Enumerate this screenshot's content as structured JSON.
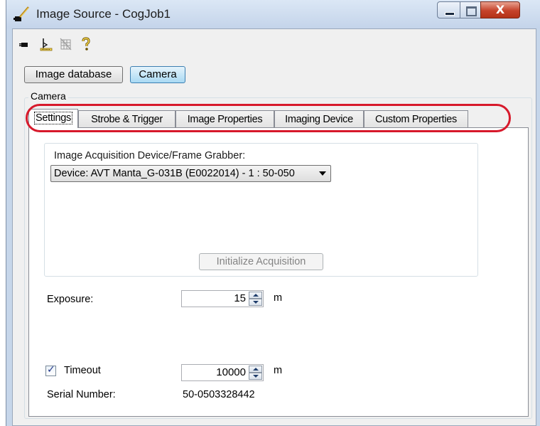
{
  "window": {
    "title": "Image Source - CogJob1",
    "close_glyph": "X",
    "icons": [
      "app-wand-icon",
      "minimize-icon",
      "maximize-icon",
      "close-icon"
    ]
  },
  "toolbar": {
    "icons": [
      "camera-plug-icon",
      "image-file-icon",
      "grid-disabled-icon",
      "help-icon"
    ]
  },
  "source_buttons": {
    "image_database": "Image database",
    "camera": "Camera"
  },
  "camera_group": {
    "label": "Camera"
  },
  "tabs": [
    {
      "label": "Settings",
      "active": true
    },
    {
      "label": "Strobe & Trigger",
      "active": false
    },
    {
      "label": "Image Properties",
      "active": false
    },
    {
      "label": "Imaging Device",
      "active": false
    },
    {
      "label": "Custom Properties",
      "active": false
    }
  ],
  "settings": {
    "device_group_label": "Image Acquisition Device/Frame Grabber:",
    "device_selected": "Device: AVT Manta_G-031B (E0022014) - 1 : 50-050",
    "initialize_label": "Initialize Acquisition",
    "exposure": {
      "label": "Exposure:",
      "value": "15",
      "unit": "m"
    },
    "timeout": {
      "label": "Timeout",
      "checked": true,
      "value": "10000",
      "unit": "m"
    },
    "serial": {
      "label": "Serial Number:",
      "value": "50-0503328442"
    }
  },
  "colors": {
    "annotation": "#d7192b",
    "camera_button": "#a9d9f3"
  }
}
